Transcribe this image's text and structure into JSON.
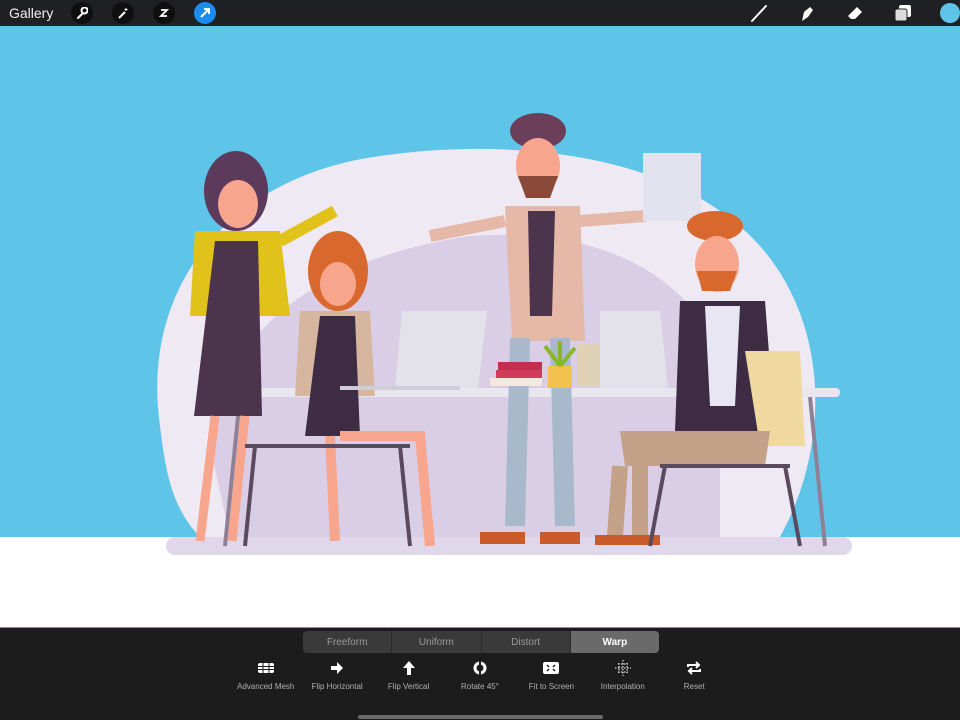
{
  "topbar": {
    "gallery_label": "Gallery",
    "left_icons": [
      "wrench-icon",
      "magic-wand-icon",
      "selection-icon",
      "transform-arrow-icon"
    ],
    "right_icons": [
      "brush-icon",
      "smudge-icon",
      "eraser-icon",
      "layers-icon"
    ],
    "current_color": "#5ec5e8"
  },
  "transform": {
    "modes": [
      "Freeform",
      "Uniform",
      "Distort",
      "Warp"
    ],
    "active_mode": "Warp",
    "tools": [
      {
        "label": "Advanced Mesh",
        "icon": "mesh-icon"
      },
      {
        "label": "Flip Horizontal",
        "icon": "arrow-right-icon"
      },
      {
        "label": "Flip Vertical",
        "icon": "arrow-up-icon"
      },
      {
        "label": "Rotate 45°",
        "icon": "rotate-icon"
      },
      {
        "label": "Fit to Screen",
        "icon": "fit-screen-icon"
      },
      {
        "label": "Interpolation",
        "icon": "interpolation-icon"
      },
      {
        "label": "Reset",
        "icon": "reset-icon"
      }
    ]
  },
  "colors": {
    "sky": "#5ec5e8",
    "blob": "#efe9f3",
    "blob_inner": "#d9cee6"
  }
}
